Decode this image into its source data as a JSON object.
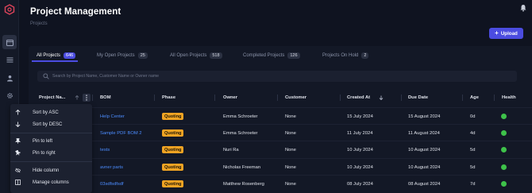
{
  "header": {
    "title": "Project Management",
    "breadcrumb": "Projects",
    "upload_label": "Upload"
  },
  "tabs": [
    {
      "label": "All Projects",
      "count": "646",
      "active": true
    },
    {
      "label": "My Open Projects",
      "count": "25",
      "active": false
    },
    {
      "label": "All Open Projects",
      "count": "518",
      "active": false
    },
    {
      "label": "Completed Projects",
      "count": "126",
      "active": false
    },
    {
      "label": "Projects On Hold",
      "count": "2",
      "active": false
    }
  ],
  "search": {
    "placeholder": "Search by Project Name, Customer Name or Owner name"
  },
  "columns": {
    "project_name": "Project Na...",
    "bom": "BOM",
    "phase": "Phase",
    "owner": "Owner",
    "customer": "Customer",
    "created_at": "Created At",
    "due_date": "Due Date",
    "age": "Age",
    "health": "Health"
  },
  "rows": [
    {
      "bom": "Help Center",
      "phase": "Quoting",
      "owner": "Emma Schroeter",
      "customer": "None",
      "created_at": "15 July 2024",
      "due_date": "15 August 2024",
      "age": "0d",
      "health": "green"
    },
    {
      "bom": "Sample PDF BOM 2",
      "phase": "Quoting",
      "owner": "Emma Schroeter",
      "customer": "None",
      "created_at": "11 July 2024",
      "due_date": "11 August 2024",
      "age": "4d",
      "health": "green"
    },
    {
      "bom": "tests",
      "phase": "Quoting",
      "owner": "Nuri Ra",
      "customer": "None",
      "created_at": "10 July 2024",
      "due_date": "10 August 2024",
      "age": "5d",
      "health": "green"
    },
    {
      "bom": "avner parts",
      "phase": "Quoting",
      "owner": "Nicholas Freeman",
      "customer": "None",
      "created_at": "10 July 2024",
      "due_date": "10 August 2024",
      "age": "5d",
      "health": "green"
    },
    {
      "bom": "03sdfsdfsdf",
      "phase": "Quoting",
      "owner": "Matthew Rosenberg",
      "customer": "None",
      "created_at": "08 July 2024",
      "due_date": "08 August 2024",
      "age": "7d",
      "health": "green"
    }
  ],
  "column_menu": {
    "sort_asc": "Sort by ASC",
    "sort_desc": "Sort by DESC",
    "pin_left": "Pin to left",
    "pin_right": "Pin to right",
    "hide_column": "Hide column",
    "manage_columns": "Manage columns"
  },
  "colors": {
    "accent": "#4b4ce0",
    "quoting": "#f0a323",
    "health_green": "#3ec24a",
    "link": "#4c8dff"
  }
}
